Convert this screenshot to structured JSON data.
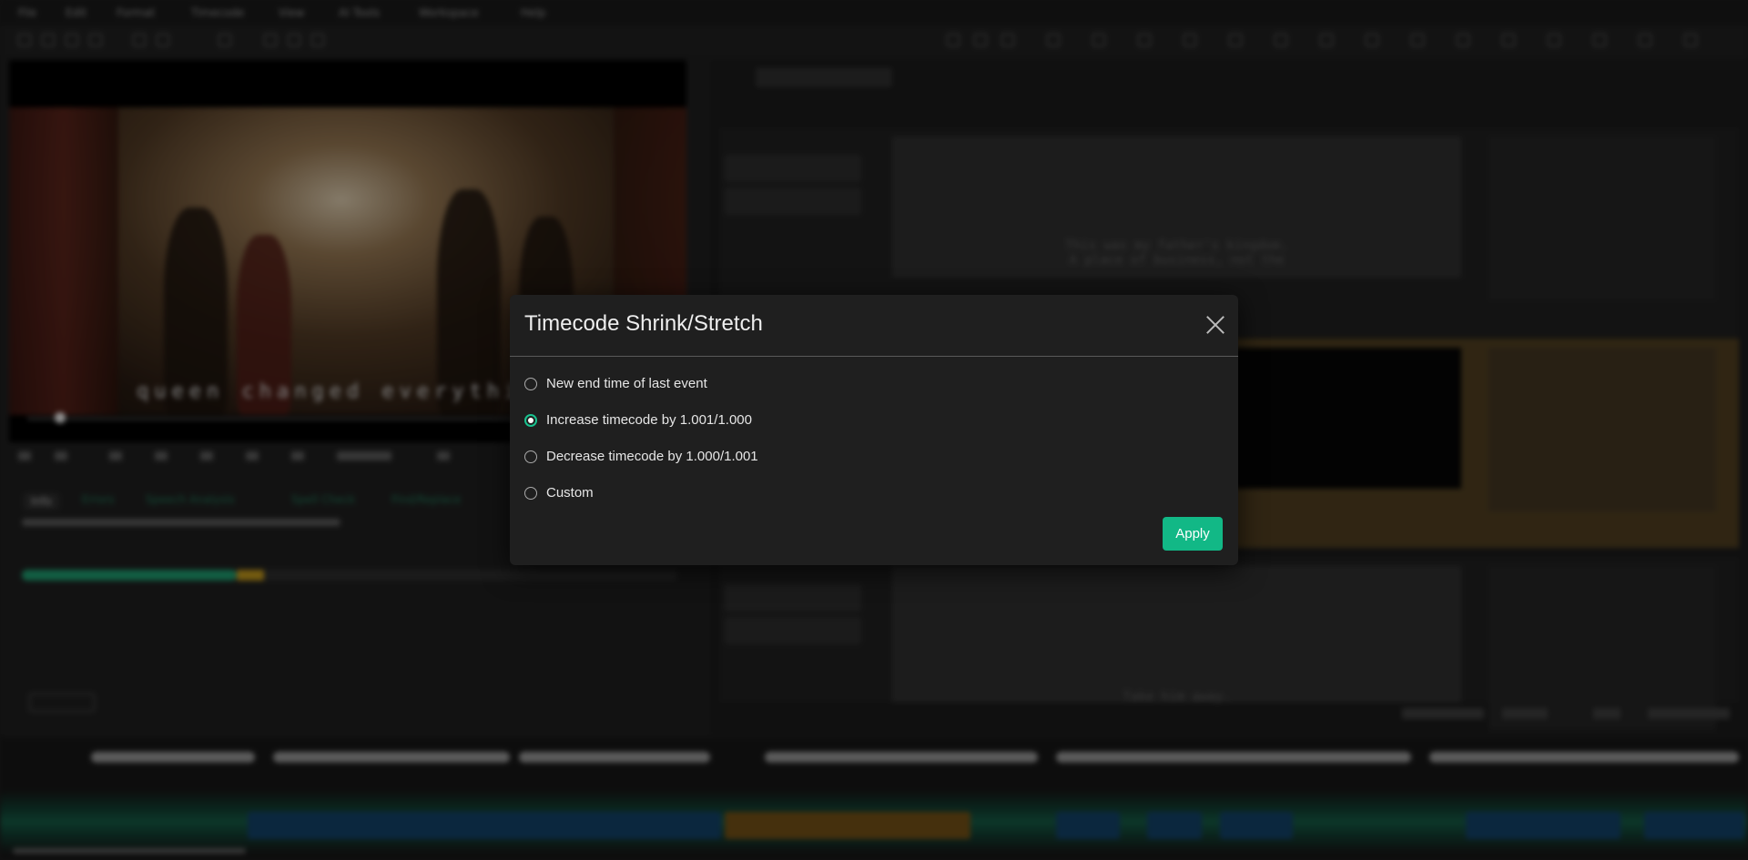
{
  "dialog": {
    "title": "Timecode Shrink/Stretch",
    "options": [
      {
        "label": "New end time of last event",
        "checked": false
      },
      {
        "label": "Increase timecode by 1.001/1.000",
        "checked": true
      },
      {
        "label": "Decrease timecode by 1.000/1.001",
        "checked": false
      },
      {
        "label": "Custom",
        "checked": false
      }
    ],
    "apply_label": "Apply"
  },
  "colors": {
    "accent": "#12b886",
    "dialog_bg": "#1f1f1f",
    "overlay": "rgba(0,0,0,0.35)"
  },
  "background": {
    "video_subtitle": "queen changed everything",
    "event_texts": [
      "This was my father's kingdom.\nA place of business, not the",
      "",
      "Take him away."
    ]
  }
}
